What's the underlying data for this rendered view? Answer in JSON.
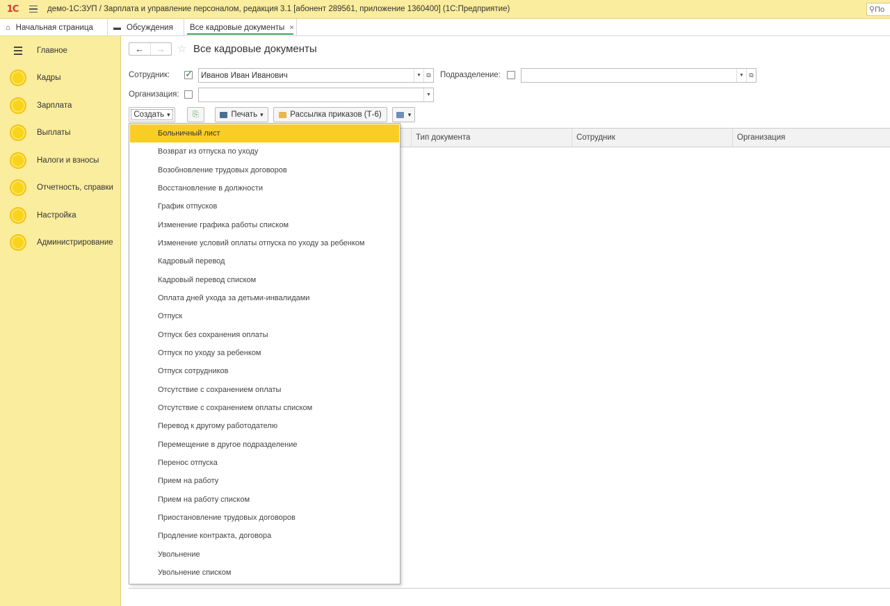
{
  "titlebar": {
    "logo": "1С",
    "title": "демо-1С:ЗУП / Зарплата и управление персоналом, редакция 3.1 [абонент 289561, приложение 1360400]  (1С:Предприятие)",
    "search_placeholder": "По"
  },
  "tabs": [
    {
      "label": "Начальная страница",
      "icon": "home-icon"
    },
    {
      "label": "Обсуждения",
      "icon": "chat-icon"
    },
    {
      "label": "Все кадровые документы",
      "icon": "",
      "active": true
    }
  ],
  "sidebar": {
    "items": [
      {
        "label": "Главное"
      },
      {
        "label": "Кадры"
      },
      {
        "label": "Зарплата"
      },
      {
        "label": "Выплаты"
      },
      {
        "label": "Налоги и взносы"
      },
      {
        "label": "Отчетность, справки"
      },
      {
        "label": "Настройка"
      },
      {
        "label": "Администрирование"
      }
    ]
  },
  "page": {
    "title": "Все кадровые документы"
  },
  "filters": {
    "employee_label": "Сотрудник:",
    "employee_checked": true,
    "employee_value": "Иванов Иван Иванович",
    "department_label": "Подразделение:",
    "department_checked": false,
    "department_value": "",
    "organization_label": "Организация:",
    "organization_checked": false,
    "organization_value": ""
  },
  "toolbar": {
    "create_label": "Создать",
    "print_label": "Печать",
    "mailing_label": "Рассылка приказов (Т-6)"
  },
  "table": {
    "columns": [
      "Тип документа",
      "Сотрудник",
      "Организация"
    ]
  },
  "create_menu": {
    "items": [
      "Больничный лист",
      "Возврат из отпуска по уходу",
      "Возобновление трудовых договоров",
      "Восстановление в должности",
      "График отпусков",
      "Изменение графика работы списком",
      "Изменение условий оплаты отпуска по уходу за ребенком",
      "Кадровый перевод",
      "Кадровый перевод списком",
      "Оплата дней ухода за детьми-инвалидами",
      "Отпуск",
      "Отпуск без сохранения оплаты",
      "Отпуск по уходу за ребенком",
      "Отпуск сотрудников",
      "Отсутствие с сохранением оплаты",
      "Отсутствие с сохранением оплаты списком",
      "Перевод к другому работодателю",
      "Перемещение в другое подразделение",
      "Перенос отпуска",
      "Прием на работу",
      "Прием на работу списком",
      "Приостановление трудовых договоров",
      "Продление контракта, договора",
      "Увольнение",
      "Увольнение списком"
    ],
    "selected_index": 0
  },
  "colors": {
    "sidebar_bg": "#fbed9e",
    "accent_yellow": "#f8cd24",
    "active_tab_underline": "#3fa05a"
  }
}
